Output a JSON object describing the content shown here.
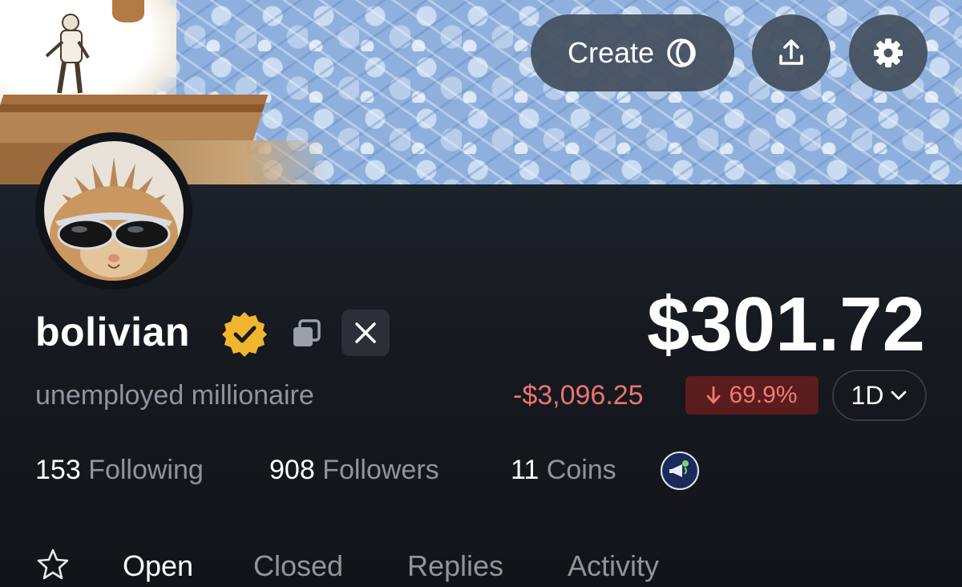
{
  "header": {
    "create_label": "Create",
    "share_icon": "share-upload-icon",
    "settings_icon": "gear-icon"
  },
  "profile": {
    "username": "bolivian",
    "verified": true,
    "bio": "unemployed millionaire",
    "verified_color": "#f2b530"
  },
  "portfolio": {
    "balance": "$301.72",
    "change": "-$3,096.25",
    "change_percent": "69.9%",
    "change_direction": "down",
    "range": "1D",
    "negative_color": "#e8746d"
  },
  "stats": {
    "following_count": "153",
    "following_label": "Following",
    "followers_count": "908",
    "followers_label": "Followers",
    "coins_count": "11",
    "coins_label": "Coins"
  },
  "tabs": [
    {
      "label": "Open",
      "active": true
    },
    {
      "label": "Closed",
      "active": false
    },
    {
      "label": "Replies",
      "active": false
    },
    {
      "label": "Activity",
      "active": false
    }
  ]
}
